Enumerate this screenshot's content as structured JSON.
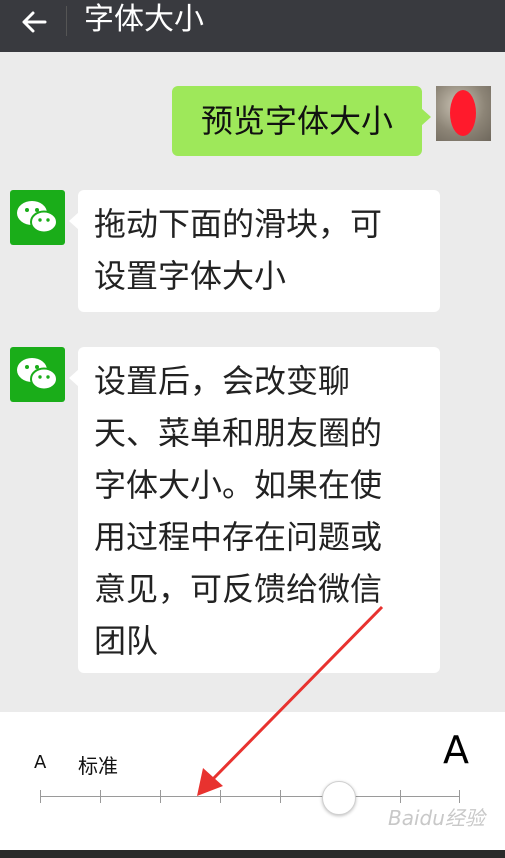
{
  "header": {
    "title": "字体大小",
    "back_icon": "arrow-left-icon"
  },
  "messages": {
    "user_preview": "预览字体大小",
    "bot_1": "拖动下面的滑块，可设置字体大小",
    "bot_2_lines": [
      "设置后，会改变聊",
      "天、菜单和朋友圈的",
      "字体大小。如果在使",
      "用过程中存在问题或",
      "意见，可反馈给微信",
      "团队"
    ],
    "bot_1_lines": [
      "拖动下面的滑块，可",
      "设置字体大小"
    ]
  },
  "slider": {
    "small_label": "A",
    "standard_label": "标准",
    "large_label": "A",
    "steps": 8,
    "selected_step": 5
  },
  "watermark": "Baidu经验",
  "colors": {
    "header_bg": "#393a3f",
    "bubble_user": "#9ee85a",
    "wechat_green": "#1aad19",
    "annotation_arrow": "#e8322f"
  }
}
